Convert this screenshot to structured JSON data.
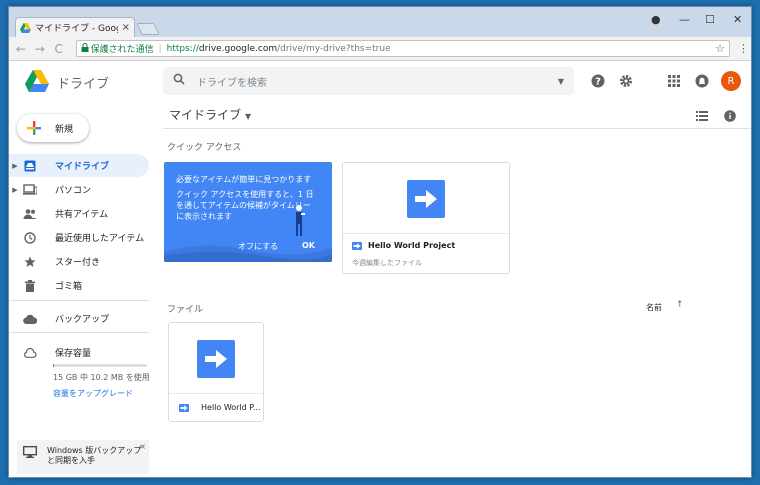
{
  "browser": {
    "tab_title": "マイドライブ - Google ドライブ",
    "tab_close": "×",
    "nav": {
      "back": "←",
      "forward": "→",
      "reload": "C"
    },
    "secure_label": "保護された通信",
    "url": {
      "scheme": "https://",
      "host": "drive.google.com",
      "path": "/drive/my-drive?ths=true"
    },
    "window_controls": {
      "account": "●",
      "minimize": "—",
      "maximize": "☐",
      "close": "✕"
    },
    "bookmark_icon": "star-icon",
    "menu_icon": "kebab-icon"
  },
  "header": {
    "app_name": "ドライブ",
    "search_placeholder": "ドライブを検索",
    "avatar_initial": "R"
  },
  "sidebar": {
    "new_button": "新規",
    "items": [
      {
        "label": "マイドライブ",
        "icon": "my-drive-icon",
        "active": true,
        "expandable": true
      },
      {
        "label": "パソコン",
        "icon": "computer-icon",
        "active": false,
        "expandable": true
      },
      {
        "label": "共有アイテム",
        "icon": "shared-people-icon",
        "active": false,
        "expandable": false
      },
      {
        "label": "最近使用したアイテム",
        "icon": "clock-icon",
        "active": false,
        "expandable": false
      },
      {
        "label": "スター付き",
        "icon": "star-icon",
        "active": false,
        "expandable": false
      },
      {
        "label": "ゴミ箱",
        "icon": "trash-icon",
        "active": false,
        "expandable": false
      }
    ],
    "backup_label": "バックアップ",
    "storage": {
      "label": "保存容量",
      "usage_text": "15 GB 中 10.2 MB を使用",
      "used_fraction": 0.01,
      "upgrade_link": "容量をアップグレード"
    },
    "promo": {
      "text_line1": "Windows 版バックアップ",
      "text_line2": "と同期を入手",
      "close": "×"
    }
  },
  "main": {
    "breadcrumb": "マイドライブ",
    "quick_access_label": "クイック アクセス",
    "promo_card": {
      "title": "必要なアイテムが簡単に見つかります",
      "body": "クイック アクセスを使用すると、1 日を通してアイテムの候補がタイムリーに表示されます",
      "off_button": "オフにする",
      "ok_button": "OK"
    },
    "quick_file": {
      "name": "Hello World Project",
      "subtitle": "今週編集したファイル"
    },
    "files_label": "ファイル",
    "sort": {
      "label": "名前",
      "direction": "↑"
    },
    "files": [
      {
        "name": "Hello World P..."
      }
    ]
  },
  "colors": {
    "accent_blue": "#4285f4",
    "active_nav_bg": "#e8f0fe",
    "avatar": "#e8580c"
  }
}
